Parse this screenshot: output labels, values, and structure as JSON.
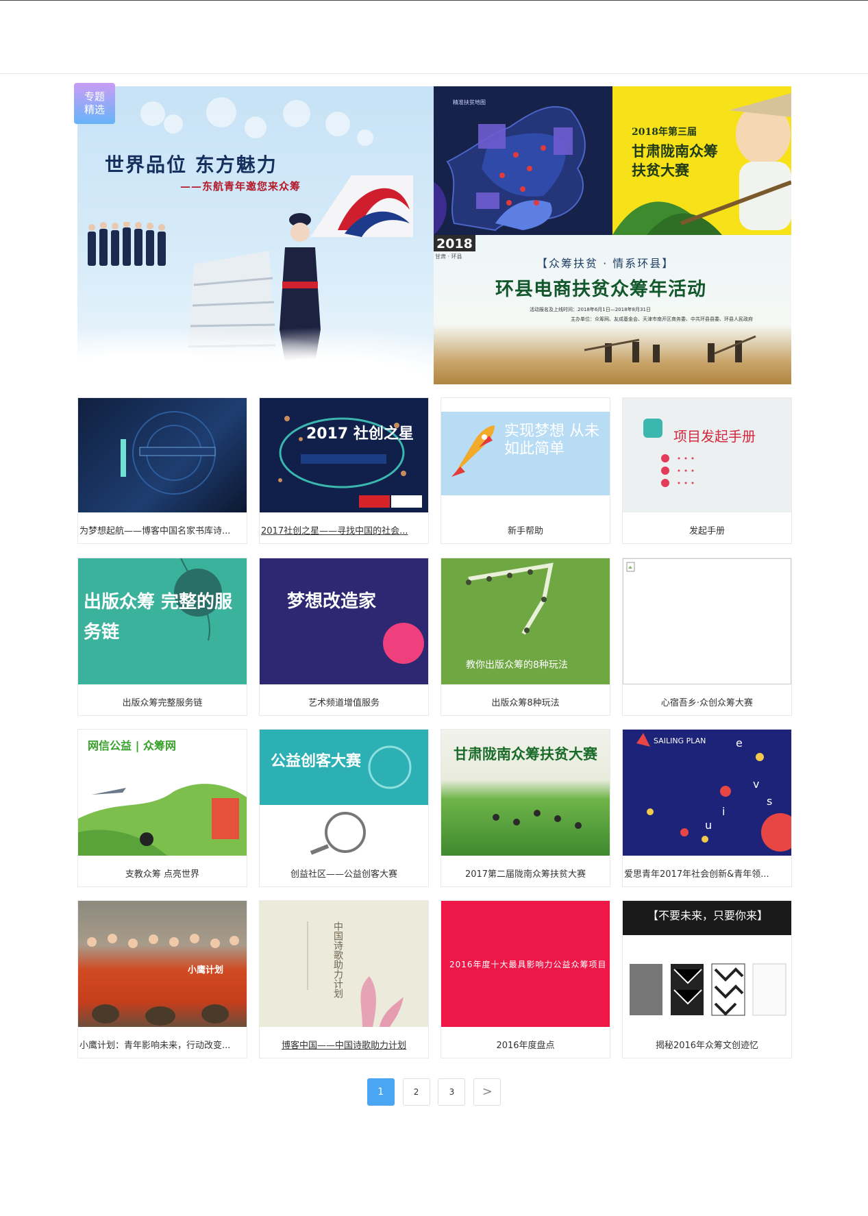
{
  "badge": {
    "line1": "专题",
    "line2": "精选"
  },
  "featured": {
    "main": {
      "title": "世界品位 东方魅力",
      "subtitle": "——东航青年邀您来众筹"
    },
    "map": {
      "caption": "精准扶贫地图"
    },
    "gansu": {
      "year_line": "2018年第三届",
      "line1": "甘肃陇南众筹",
      "line2": "扶贫大赛"
    },
    "huanxian": {
      "year": "2018",
      "region": "甘肃 · 环县",
      "sub": "【众筹扶贫 · 情系环县】",
      "main": "环县电商扶贫众筹年活动",
      "info1": "活动报名及上线时间：2018年6月1日—2018年8月31日",
      "info2": "主办单位：众筹网、友成基金会、天津市南开区商务委、中共环县县委、环县人民政府"
    }
  },
  "cards": [
    {
      "title": "为梦想起航——博客中国名家书库诗...",
      "img_text": ""
    },
    {
      "title": "2017社创之星——寻找中国的社会...",
      "img_text": "2017 社创之星"
    },
    {
      "title": "新手帮助",
      "img_text": "实现梦想 从未如此简单"
    },
    {
      "title": "发起手册",
      "img_text": "项目发起手册"
    },
    {
      "title": "出版众筹完整服务链",
      "img_text": "出版众筹 完整的服务链"
    },
    {
      "title": "艺术频道增值服务",
      "img_text": "梦想改造家"
    },
    {
      "title": "出版众筹8种玩法",
      "img_text": "教你出版众筹的8种玩法"
    },
    {
      "title": "心宿吾乡·众创众筹大赛",
      "img_text": ""
    },
    {
      "title": "支教众筹 点亮世界",
      "img_text": "网信公益 | 众筹网"
    },
    {
      "title": "创益社区——公益创客大赛",
      "img_text": "公益创客大赛"
    },
    {
      "title": "2017第二届陇南众筹扶贫大赛",
      "img_text": "甘肃陇南众筹扶贫大赛"
    },
    {
      "title": "爱思青年2017年社会创新&青年领...",
      "img_text": "SAILING PLAN"
    },
    {
      "title": "小鹰计划：青年影响未来，行动改变...",
      "img_text": "小鹰计划"
    },
    {
      "title": "博客中国——中国诗歌助力计划",
      "img_text": "中国诗歌助力计划"
    },
    {
      "title": "2016年度盘点",
      "img_text": "2016年度十大最具影响力公益众筹项目"
    },
    {
      "title": "揭秘2016年众筹文创迹忆",
      "img_text": "【不要未来，只要你来】"
    }
  ],
  "pagination": {
    "pages": [
      "1",
      "2",
      "3"
    ],
    "next": ">",
    "current": "1"
  },
  "colors": {
    "accent": "#4aa6f2",
    "badge_top": "#c99cf5",
    "badge_bottom": "#66b4f7"
  }
}
